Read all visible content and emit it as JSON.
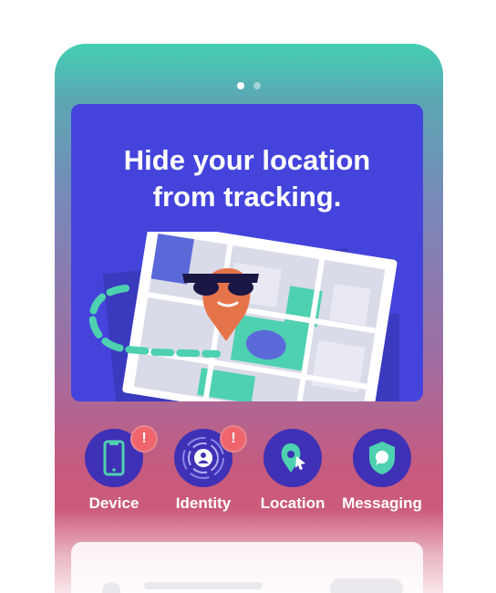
{
  "carousel": {
    "pages": 2,
    "active_index": 0
  },
  "hero": {
    "title_line1": "Hide your location",
    "title_line2": "from tracking."
  },
  "features": [
    {
      "label": "Device",
      "icon": "phone-icon",
      "alert": true,
      "alert_symbol": "!"
    },
    {
      "label": "Identity",
      "icon": "identity-icon",
      "alert": true,
      "alert_symbol": "!"
    },
    {
      "label": "Location",
      "icon": "location-pin-icon",
      "alert": false
    },
    {
      "label": "Messaging",
      "icon": "shield-chat-icon",
      "alert": false
    }
  ],
  "colors": {
    "card_bg": "#4444dc",
    "icon_circle": "#3f31b5",
    "badge": "#f0646c",
    "accent_teal": "#43cfb3",
    "pin_orange": "#e6744a"
  }
}
